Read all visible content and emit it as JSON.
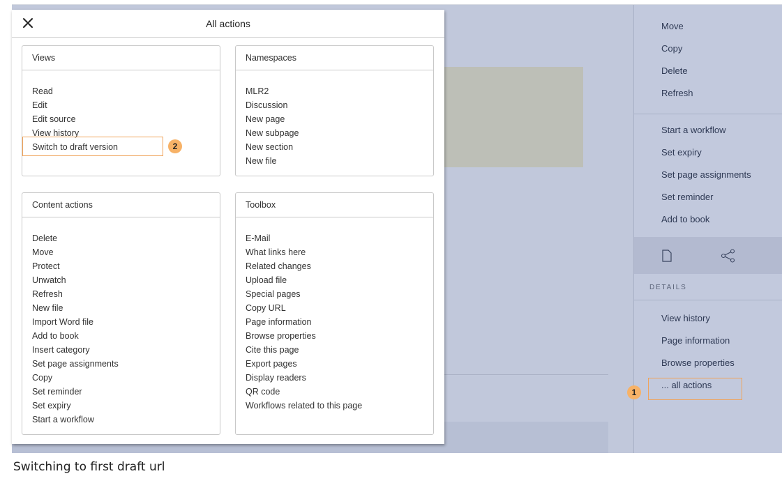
{
  "modal": {
    "title": "All actions",
    "close_icon": "close-icon",
    "views": {
      "heading": "Views",
      "items": [
        "Read",
        "Edit",
        "Edit source",
        "View history",
        "Switch to draft version"
      ]
    },
    "namespaces": {
      "heading": "Namespaces",
      "items": [
        "MLR2",
        "Discussion",
        "New page",
        "New subpage",
        "New section",
        "New file"
      ]
    },
    "content_actions": {
      "heading": "Content actions",
      "items": [
        "Delete",
        "Move",
        "Protect",
        "Unwatch",
        "Refresh",
        "New file",
        "Import Word file",
        "Add to book",
        "Insert category",
        "Set page assignments",
        "Copy",
        "Set reminder",
        "Set expiry",
        "Start a workflow"
      ]
    },
    "toolbox": {
      "heading": "Toolbox",
      "items": [
        "E-Mail",
        "What links here",
        "Related changes",
        "Upload file",
        "Special pages",
        "Copy URL",
        "Page information",
        "Browse properties",
        "Cite this page",
        "Export pages",
        "Display readers",
        "QR code",
        "Workflows related to this page"
      ]
    }
  },
  "sidebar": {
    "group1": [
      "Move",
      "Copy",
      "Delete",
      "Refresh"
    ],
    "group2": [
      "Start a workflow",
      "Set expiry",
      "Set page assignments",
      "Set reminder",
      "Add to book"
    ],
    "icons": [
      "page-icon",
      "share-icon"
    ],
    "details_heading": "DETAILS",
    "group3": [
      "View history",
      "Page information",
      "Browse properties",
      "... all actions"
    ]
  },
  "callouts": {
    "badge1": "1",
    "badge2": "2",
    "color": "#f0a35a"
  },
  "caption": "Switching to first draft url"
}
